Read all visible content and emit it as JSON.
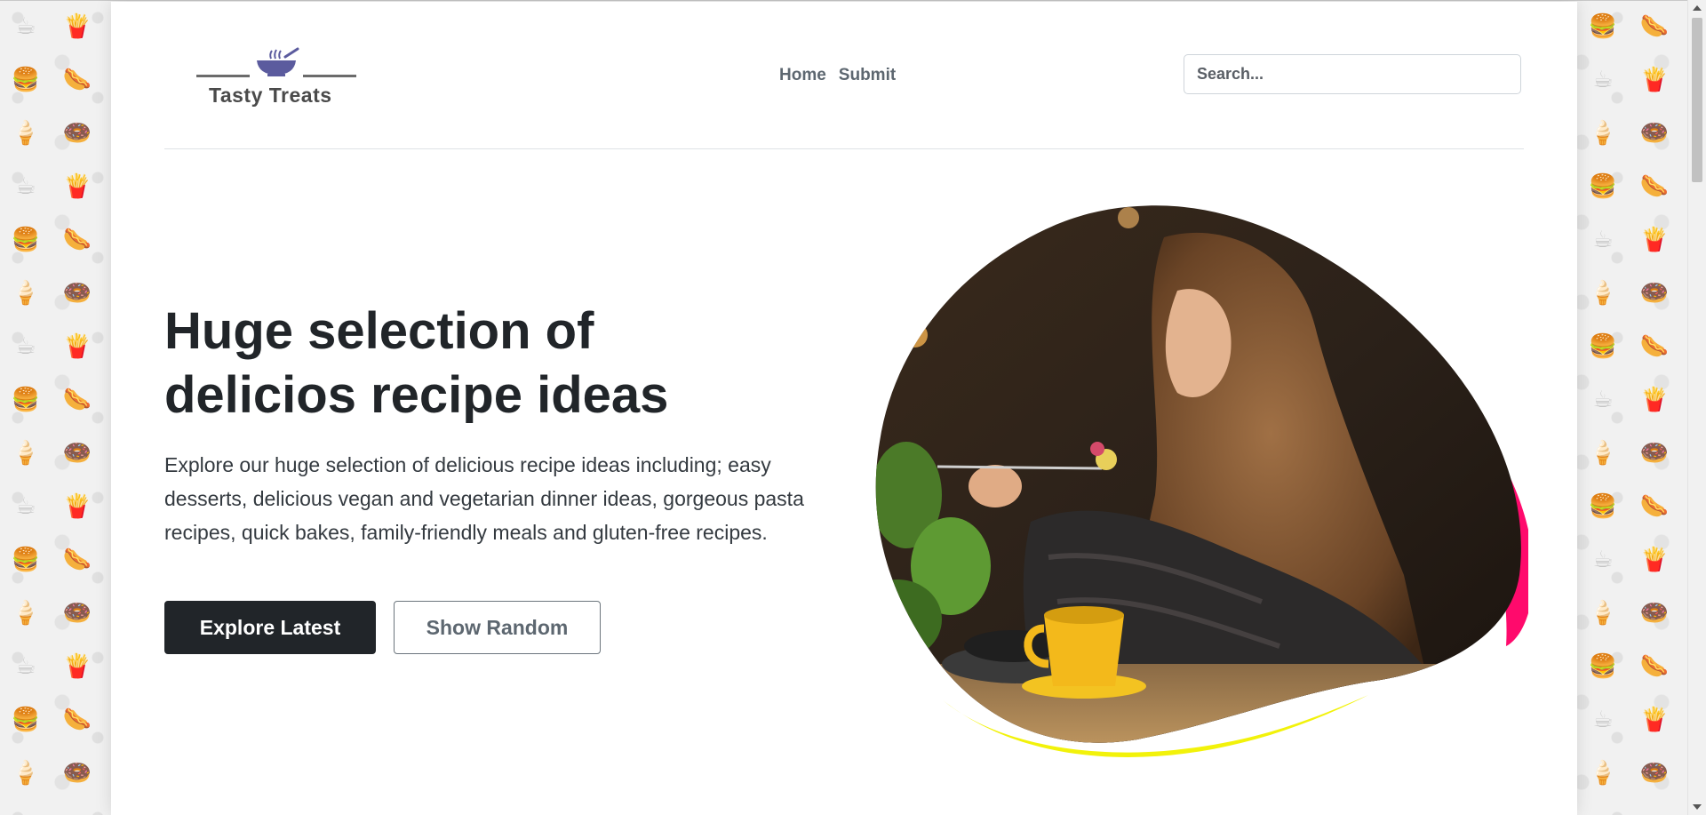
{
  "site": {
    "logo_text": "Tasty Treats"
  },
  "nav": {
    "items": [
      {
        "label": "Home"
      },
      {
        "label": "Submit"
      }
    ]
  },
  "search": {
    "placeholder": "Search..."
  },
  "hero": {
    "title": "Huge selection of delicios recipe ideas",
    "description": "Explore our huge selection of delicious recipe ideas including; easy desserts, delicious vegan and vegetarian dinner ideas, gorgeous pasta recipes, quick bakes, family-friendly meals and gluten-free recipes.",
    "primary_button": "Explore Latest",
    "secondary_button": "Show Random"
  },
  "colors": {
    "accent_pink": "#ff0a6c",
    "accent_yellow": "#f2f20a",
    "dark": "#212529",
    "logo_purple": "#5b5b9e"
  },
  "icons": [
    "soup-bowl-icon",
    "food-pattern-icons"
  ]
}
